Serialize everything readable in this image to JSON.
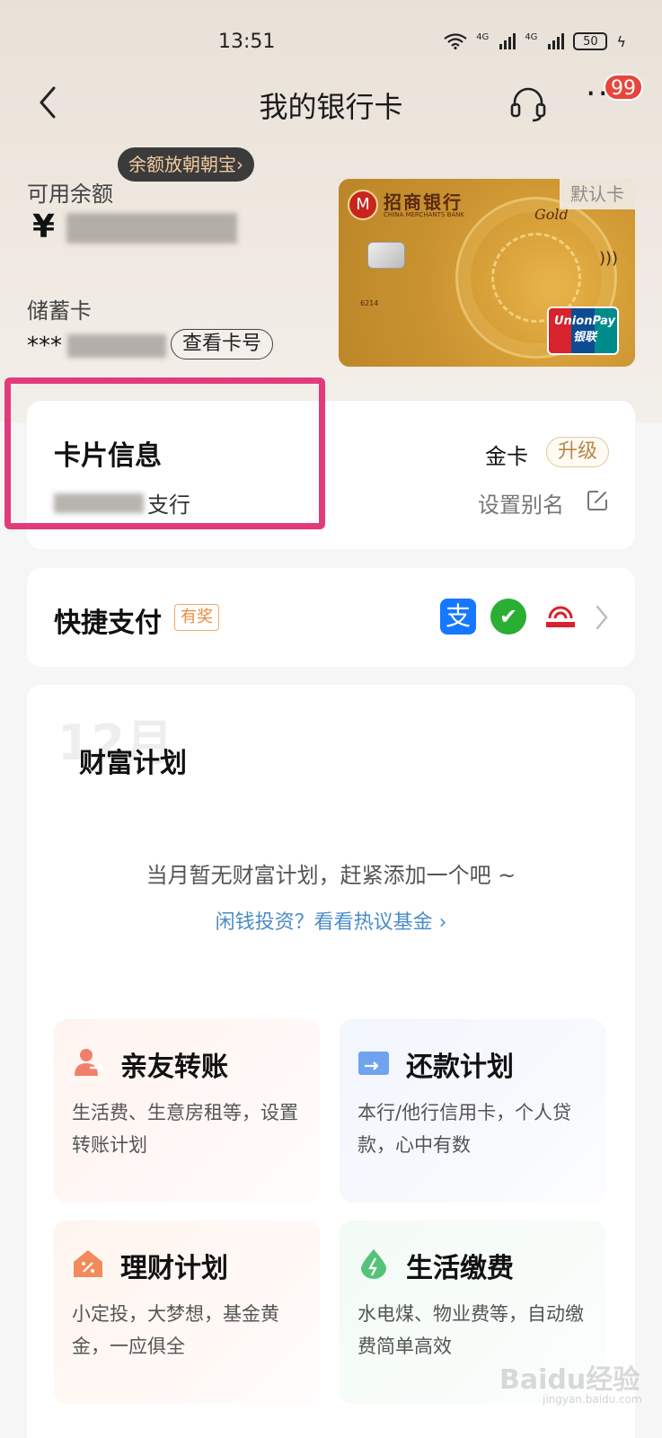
{
  "status_bar": {
    "time": "13:51",
    "net_1": "4G",
    "net_2": "4G",
    "battery": "50"
  },
  "header": {
    "title": "我的银行卡",
    "notification_count": "99",
    "more": "···"
  },
  "balance": {
    "promo": "余额放朝朝宝›",
    "label": "可用余额",
    "currency": "¥",
    "card_type": "储蓄卡",
    "card_prefix": "***",
    "view_card_button": "查看卡号"
  },
  "bank_card": {
    "bank_name": "招商银行",
    "bank_name_en": "CHINA MERCHANTS BANK",
    "tier": "Gold",
    "default_tag": "默认卡",
    "number_prefix": "6214",
    "network": "UnionPay",
    "network_cn": "银联"
  },
  "card_info": {
    "title": "卡片信息",
    "branch_suffix": "支行",
    "level": "金卡",
    "upgrade": "升级",
    "set_alias": "设置别名"
  },
  "quick_pay": {
    "title": "快捷支付",
    "badge": "有奖"
  },
  "wealth": {
    "month": "12月",
    "title": "财富计划",
    "empty_text": "当月暂无财富计划，赶紧添加一个吧 ~",
    "fund_link": "闲钱投资？看看热议基金 ›",
    "tiles": [
      {
        "title": "亲友转账",
        "desc": "生活费、生意房租等，设置转账计划",
        "icon": "person-transfer-icon",
        "color": "#f0806a"
      },
      {
        "title": "还款计划",
        "desc": "本行/他行信用卡，个人贷款，心中有数",
        "icon": "card-repay-icon",
        "color": "#6fa3ef"
      },
      {
        "title": "理财计划",
        "desc": "小定投，大梦想，基金黄金，一应俱全",
        "icon": "wealth-house-icon",
        "color": "#f28b5a"
      },
      {
        "title": "生活缴费",
        "desc": "水电煤、物业费等，自动缴费简单高效",
        "icon": "utility-drop-icon",
        "color": "#55c27a"
      }
    ]
  },
  "watermark": {
    "main": "Baidu经验",
    "sub": "jingyan.baidu.com"
  },
  "colors": {
    "highlight": "#e23b7b",
    "badge": "#e8453c",
    "link": "#4a8cc8",
    "upgrade": "#b8864a"
  }
}
